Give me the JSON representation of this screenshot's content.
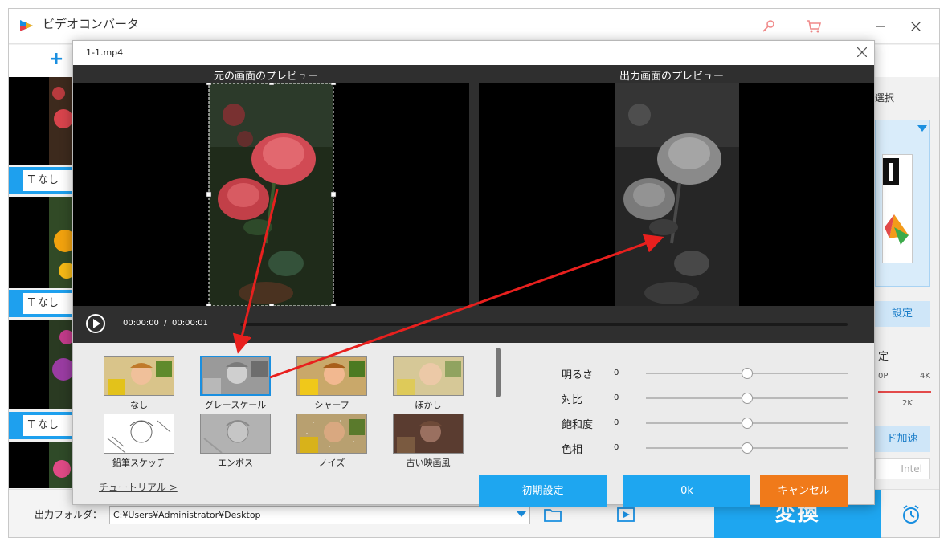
{
  "window": {
    "title": "ビデオコンバータ"
  },
  "list": {
    "items": [
      {
        "text_label": "なし"
      },
      {
        "text_label": "なし"
      },
      {
        "text_label": "なし"
      }
    ]
  },
  "right_panel": {
    "format_label": "選択",
    "settings_label": "設定",
    "quality_label": "定",
    "tick_480p": "0P",
    "tick_4k": "4K",
    "tick_2k": "2K",
    "hw_accel_label": "ド加速",
    "intel_label": "Intel"
  },
  "bottom": {
    "output_folder_label": "出力フォルダ：",
    "output_path": "C:¥Users¥Administrator¥Desktop",
    "convert_label": "変換"
  },
  "dialog": {
    "title": "1-1.mp4",
    "original_preview_label": "元の画面のプレビュー",
    "output_preview_label": "出力画面のプレビュー",
    "current_time": "00:00:00",
    "separator": "/",
    "total_time": "00:00:01",
    "filters": [
      {
        "label": "なし",
        "selected": false
      },
      {
        "label": "グレースケール",
        "selected": true
      },
      {
        "label": "シャープ",
        "selected": false
      },
      {
        "label": "ぼかし",
        "selected": false
      },
      {
        "label": "鉛筆スケッチ",
        "selected": false
      },
      {
        "label": "エンボス",
        "selected": false
      },
      {
        "label": "ノイズ",
        "selected": false
      },
      {
        "label": "古い映画風",
        "selected": false
      }
    ],
    "adjustments": [
      {
        "label": "明るさ",
        "value": "0"
      },
      {
        "label": "対比",
        "value": "0"
      },
      {
        "label": "飽和度",
        "value": "0"
      },
      {
        "label": "色相",
        "value": "0"
      }
    ],
    "tutorial_label": "チュートリアル >",
    "reset_label": "初期設定",
    "ok_label": "0k",
    "cancel_label": "キャンセル"
  },
  "colors": {
    "accent_blue": "#1ea6f0",
    "cancel_orange": "#f07a1a",
    "arrow_red": "#e8201e"
  }
}
